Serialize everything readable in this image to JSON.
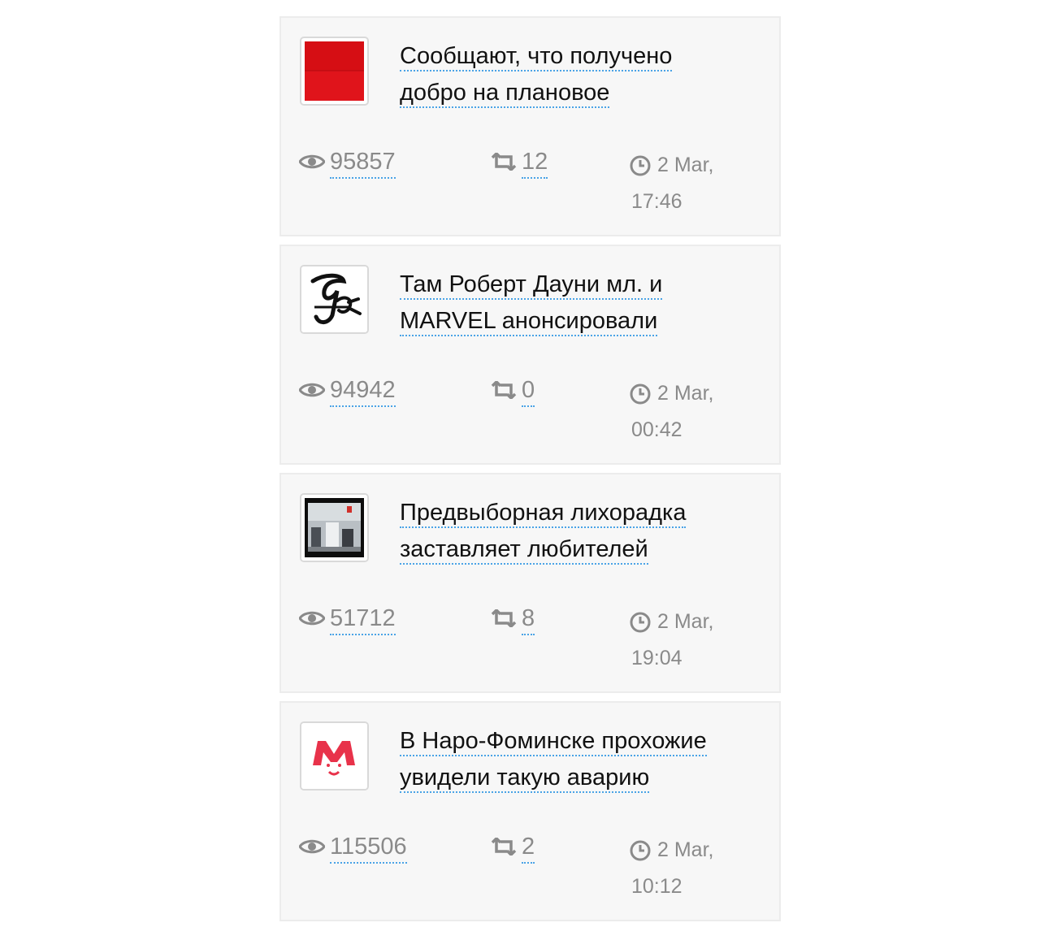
{
  "posts": [
    {
      "title_line1": "Сообщают, что получено",
      "title_line2": "добро на плановое",
      "thumbnail": "red-square-image",
      "views": "95857",
      "reposts": "12",
      "date": "2 Mar,",
      "time": "17:46"
    },
    {
      "title_line1": "Там Роберт Дауни мл. и",
      "title_line2": "MARVEL анонсировали",
      "thumbnail": "script-logo-image",
      "views": "94942",
      "reposts": "0",
      "date": "2 Mar,",
      "time": "00:42"
    },
    {
      "title_line1": "Предвыборная лихорадка",
      "title_line2": "заставляет любителей",
      "thumbnail": "room-photo-image",
      "views": "51712",
      "reposts": "8",
      "date": "2 Mar,",
      "time": "19:04"
    },
    {
      "title_line1": "В Наро-Фоминске прохожие",
      "title_line2": "увидели такую аварию",
      "thumbnail": "red-m-logo-image",
      "views": "115506",
      "reposts": "2",
      "date": "2 Mar,",
      "time": "10:12"
    }
  ],
  "icons": {
    "views": "eye-icon",
    "reposts": "repost-icon",
    "time": "clock-icon"
  },
  "colors": {
    "card_background": "#f7f7f7",
    "link_underline": "#4aa3e6",
    "stat_text": "#8a8a8a",
    "title_text": "#111111"
  }
}
